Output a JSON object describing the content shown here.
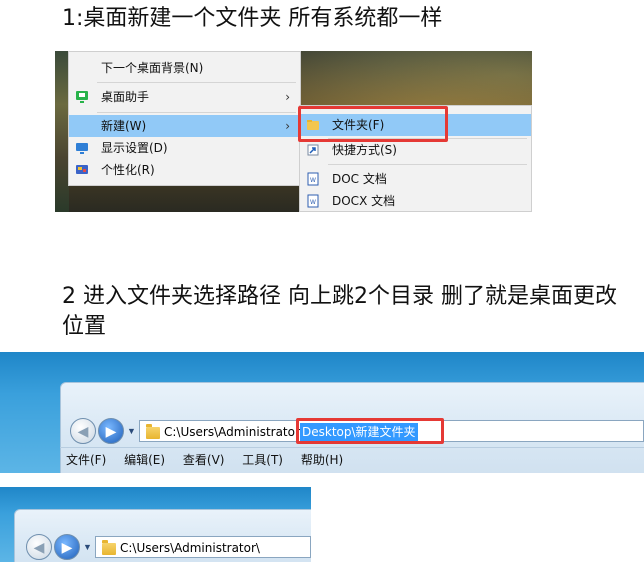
{
  "step1": {
    "heading": "1:桌面新建一个文件夹 所有系统都一样",
    "menu": {
      "items": [
        {
          "label": "下一个桌面背景(N)"
        },
        {
          "label": "桌面助手",
          "arrow": "›"
        },
        {
          "label": "新建(W)",
          "arrow": "›"
        },
        {
          "label": "显示设置(D)"
        },
        {
          "label": "个性化(R)"
        }
      ]
    },
    "submenu": {
      "items": [
        {
          "label": "文件夹(F)"
        },
        {
          "label": "快捷方式(S)"
        },
        {
          "label": "DOC 文档"
        },
        {
          "label": "DOCX 文档"
        }
      ]
    }
  },
  "step2": {
    "heading": "2 进入文件夹选择路径 向上跳2个目录 删了就是桌面更改位置",
    "address": {
      "path_prefix": "C:\\Users\\Administrator\\",
      "selected": "Desktop\\新建文件夹"
    },
    "menubar": [
      "文件(F)",
      "编辑(E)",
      "查看(V)",
      "工具(T)",
      "帮助(H)"
    ],
    "address2": {
      "path": "C:\\Users\\Administrator\\"
    }
  },
  "icons": {
    "back": "back-arrow-icon",
    "forward": "forward-arrow-icon",
    "folder": "folder-icon"
  },
  "colors": {
    "highlight": "#91c9f7",
    "selection": "#3399ff",
    "callout": "#e53935"
  }
}
